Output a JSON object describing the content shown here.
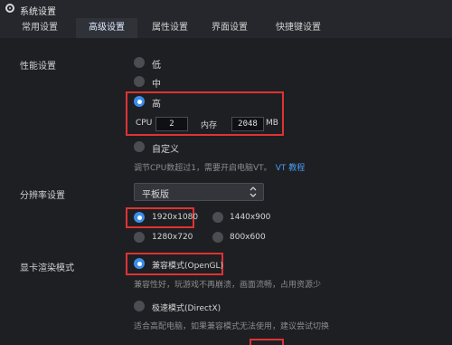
{
  "window": {
    "title": "系统设置"
  },
  "tabs": [
    "常用设置",
    "高级设置",
    "属性设置",
    "界面设置",
    "快捷键设置"
  ],
  "performance": {
    "label": "性能设置",
    "options": [
      "低",
      "中",
      "高",
      "自定义"
    ],
    "cpu_label": "CPU",
    "cpu_value": "2",
    "mem_label": "内存",
    "mem_value": "2048",
    "mem_unit": "MB",
    "hint_text": "调节CPU数超过1，需要开启电脑VT。",
    "hint_link": "VT 教程"
  },
  "resolution": {
    "label": "分辨率设置",
    "selected": "平板版",
    "options": [
      "1920x1080",
      "1440x900",
      "1280x720",
      "800x600"
    ]
  },
  "render": {
    "label": "显卡渲染模式",
    "compat_label": "兼容模式(OpenGL)",
    "compat_hint": "兼容性好，玩游戏不再崩溃，画面流畅，占用资源少",
    "speed_label": "极速模式(DirectX)",
    "speed_hint": "适合高配电脑，如果兼容模式无法使用，建议尝试切换"
  },
  "colors": {
    "accent": "#3b8ee8",
    "highlight": "#e03232",
    "background": "#1e1f23"
  }
}
